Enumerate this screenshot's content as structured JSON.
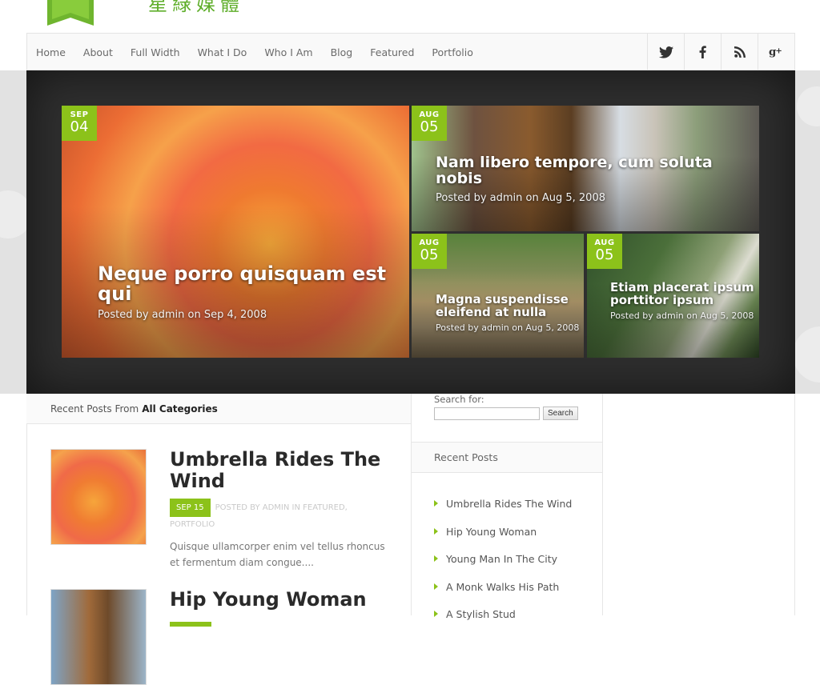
{
  "site": {
    "logo_text": "星綠媒體",
    "accent_color": "#8cc21a"
  },
  "nav": {
    "items": [
      "Home",
      "About",
      "Full Width",
      "What I Do",
      "Who I Am",
      "Blog",
      "Featured",
      "Portfolio"
    ],
    "social": [
      "twitter-icon",
      "facebook-icon",
      "rss-icon",
      "google-plus-icon"
    ]
  },
  "featured": [
    {
      "month": "SEP",
      "day": "04",
      "title": "Neque porro quisquam est qui",
      "meta": "Posted by admin on Sep 4, 2008"
    },
    {
      "month": "AUG",
      "day": "05",
      "title": "Nam libero tempore, cum soluta nobis",
      "meta": "Posted by admin on Aug 5, 2008"
    },
    {
      "month": "AUG",
      "day": "05",
      "title": "Magna suspendisse eleifend at nulla",
      "meta": "Posted by admin on Aug 5, 2008"
    },
    {
      "month": "AUG",
      "day": "05",
      "title": "Etiam placerat ipsum porttitor ipsum",
      "meta": "Posted by admin on Aug 5, 2008"
    }
  ],
  "recent_posts": {
    "heading_prefix": "Recent Posts From",
    "heading_bold": "All Categories",
    "posts": [
      {
        "title": "Umbrella Rides The Wind",
        "date": "SEP 15",
        "meta": "POSTED BY ADMIN IN FEATURED, PORTFOLIO",
        "excerpt": "Quisque ullamcorper enim vel tellus rhoncus et fermentum diam congue...."
      },
      {
        "title": "Hip Young Woman"
      }
    ]
  },
  "sidebar": {
    "search_label": "Search for:",
    "search_value": "",
    "search_button": "Search",
    "recent_heading": "Recent Posts",
    "recent_items": [
      "Umbrella Rides The Wind",
      "Hip Young Woman",
      "Young Man In The City",
      "A Monk Walks His Path",
      "A Stylish Stud"
    ]
  }
}
